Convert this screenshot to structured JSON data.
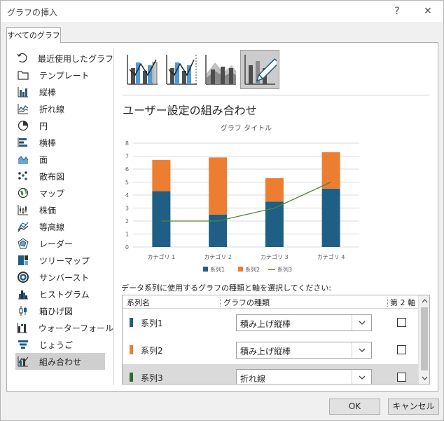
{
  "window": {
    "title": "グラフの挿入",
    "help_glyph": "?",
    "close_glyph": "✕"
  },
  "tabs": [
    {
      "label": "すべてのグラフ"
    }
  ],
  "sidebar": {
    "items": [
      {
        "label": "最近使用したグラフ",
        "icon": "recent-icon"
      },
      {
        "label": "テンプレート",
        "icon": "folder-icon"
      },
      {
        "label": "縦棒",
        "icon": "column-chart-icon"
      },
      {
        "label": "折れ線",
        "icon": "line-chart-icon"
      },
      {
        "label": "円",
        "icon": "pie-chart-icon"
      },
      {
        "label": "横棒",
        "icon": "bar-chart-icon"
      },
      {
        "label": "面",
        "icon": "area-chart-icon"
      },
      {
        "label": "散布図",
        "icon": "scatter-chart-icon"
      },
      {
        "label": "マップ",
        "icon": "map-chart-icon"
      },
      {
        "label": "株価",
        "icon": "stock-chart-icon"
      },
      {
        "label": "等高線",
        "icon": "surface-chart-icon"
      },
      {
        "label": "レーダー",
        "icon": "radar-chart-icon"
      },
      {
        "label": "ツリーマップ",
        "icon": "treemap-chart-icon"
      },
      {
        "label": "サンバースト",
        "icon": "sunburst-chart-icon"
      },
      {
        "label": "ヒストグラム",
        "icon": "histogram-chart-icon"
      },
      {
        "label": "箱ひげ図",
        "icon": "boxwhisker-chart-icon"
      },
      {
        "label": "ウォーターフォール",
        "icon": "waterfall-chart-icon"
      },
      {
        "label": "じょうご",
        "icon": "funnel-chart-icon"
      },
      {
        "label": "組み合わせ",
        "icon": "combo-chart-icon",
        "selected": true
      }
    ]
  },
  "subtypes": [
    {
      "name": "clustered-column-line"
    },
    {
      "name": "clustered-column-line-secondary"
    },
    {
      "name": "stacked-area-clustered-column"
    },
    {
      "name": "custom-combination",
      "selected": true
    }
  ],
  "section_title": "ユーザー設定の組み合わせ",
  "colors": {
    "series1": "#1f5f86",
    "series2": "#ed7d31",
    "series3": "#548235",
    "series3_swatch": "#2e6b2e"
  },
  "chart_data": {
    "type": "bar",
    "title": "グラフ タイトル",
    "categories": [
      "カテゴリ 1",
      "カテゴリ 2",
      "カテゴリ 3",
      "カテゴリ 4"
    ],
    "series": [
      {
        "name": "系列1",
        "type": "stacked-bar",
        "values": [
          4.3,
          2.5,
          3.5,
          4.5
        ]
      },
      {
        "name": "系列2",
        "type": "stacked-bar",
        "values": [
          2.4,
          4.4,
          1.8,
          2.8
        ]
      },
      {
        "name": "系列3",
        "type": "line",
        "values": [
          2,
          2,
          3,
          5
        ]
      }
    ],
    "ylim": [
      0,
      8
    ],
    "yticks": [
      0,
      1,
      2,
      3,
      4,
      5,
      6,
      7,
      8
    ],
    "grid": true,
    "legend": "bottom"
  },
  "series_prompt": "データ系列に使用するグラフの種類と軸を選択してください:",
  "series_table": {
    "headers": {
      "name": "系列名",
      "type": "グラフの種類",
      "axis": "第 2 軸"
    },
    "rows": [
      {
        "name": "系列1",
        "type": "積み上げ縦棒",
        "secondary": false
      },
      {
        "name": "系列2",
        "type": "積み上げ縦棒",
        "secondary": false
      },
      {
        "name": "系列3",
        "type": "折れ線",
        "secondary": false,
        "selected": true
      }
    ]
  },
  "buttons": {
    "ok": "OK",
    "cancel": "キャンセル"
  }
}
